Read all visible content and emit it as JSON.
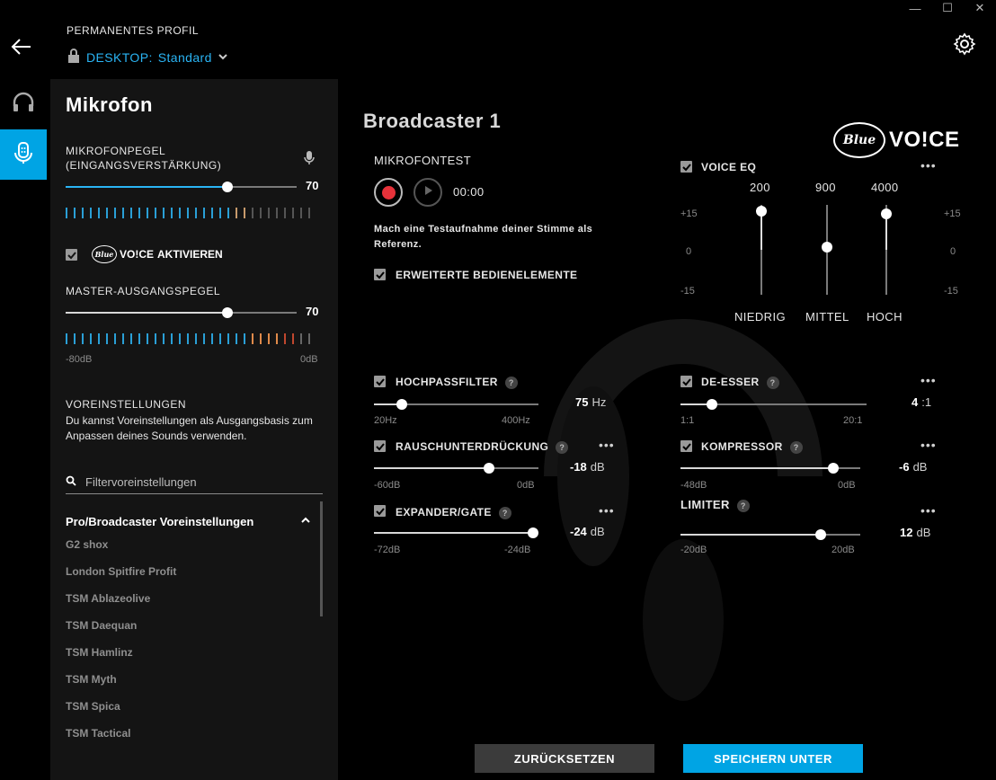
{
  "window": {
    "minimize": "—",
    "maximize": "☐",
    "close": "✕"
  },
  "header": {
    "profile_label": "PERMANENTES PROFIL",
    "device": "DESKTOP:",
    "profile_name": "Standard"
  },
  "sidebar": {
    "items": [
      {
        "name": "headset-icon"
      },
      {
        "name": "microphone-icon"
      }
    ]
  },
  "panel": {
    "title": "Mikrofon",
    "mic_level_label": "MIKROFONPEGEL\n(EINGANGSVERSTÄRKUNG)",
    "mic_level_value": "70",
    "mic_level_pct": 70,
    "voice_enable_label": "AKTIVIEREN",
    "voice_brand": "Blue",
    "voice_word": "VO!CE",
    "master_label": "MASTER-AUSGANGSPEGEL",
    "master_value": "70",
    "master_pct": 70,
    "meter_min": "-80dB",
    "meter_max": "0dB",
    "presets_label": "VOREINSTELLUNGEN",
    "presets_desc": "Du kannst Voreinstellungen als Ausgangsbasis zum Anpassen deines Sounds verwenden.",
    "search_placeholder": "Filtervoreinstellungen",
    "group_title": "Pro/Broadcaster Voreinstellungen",
    "presets": [
      "G2 shox",
      "London Spitfire Profit",
      "TSM Ablazeolive",
      "TSM Daequan",
      "TSM Hamlinz",
      "TSM Myth",
      "TSM Spica",
      "TSM Tactical"
    ]
  },
  "main": {
    "title": "Broadcaster 1",
    "brand_blue": "Blue",
    "brand_voice": "VO!CE",
    "mic_test_label": "MIKROFONTEST",
    "timer": "00:00",
    "mic_test_desc": "Mach eine Testaufnahme deiner Stimme als Referenz.",
    "advanced_label": "ERWEITERTE BEDIENELEMENTE",
    "voice_eq": {
      "label": "VOICE EQ",
      "freqs": [
        "200",
        "900",
        "4000"
      ],
      "bands": [
        "NIEDRIG",
        "MITTEL",
        "HOCH"
      ],
      "scale": [
        "+15",
        "0",
        "-15"
      ],
      "gains": [
        15,
        0,
        15
      ]
    },
    "highpass": {
      "label": "HOCHPASSFILTER",
      "value": "75",
      "unit": "Hz",
      "min": "20Hz",
      "max": "400Hz",
      "pct": 17
    },
    "noise": {
      "label": "RAUSCHUNTERDRÜCKUNG",
      "value": "-18",
      "unit": "dB",
      "min": "-60dB",
      "max": "0dB",
      "pct": 70
    },
    "expander": {
      "label": "EXPANDER/GATE",
      "value": "-24",
      "unit": "dB",
      "min": "-72dB",
      "max": "-24dB",
      "pct": 100
    },
    "deesser": {
      "label": "DE-ESSER",
      "value": "4",
      "unit": ":1",
      "min": "1:1",
      "max": "20:1",
      "pct": 17
    },
    "compressor": {
      "label": "KOMPRESSOR",
      "value": "-6",
      "unit": "dB",
      "min": "-48dB",
      "max": "0dB",
      "pct": 87
    },
    "limiter": {
      "label": "LIMITER",
      "value": "12",
      "unit": "dB",
      "min": "-20dB",
      "max": "20dB",
      "pct": 78
    },
    "help": "?",
    "more": "•••"
  },
  "buttons": {
    "reset": "ZURÜCKSETZEN",
    "save_as": "SPEICHERN UNTER"
  },
  "colors": {
    "accent": "#00a4e4",
    "record": "#e8323a"
  }
}
